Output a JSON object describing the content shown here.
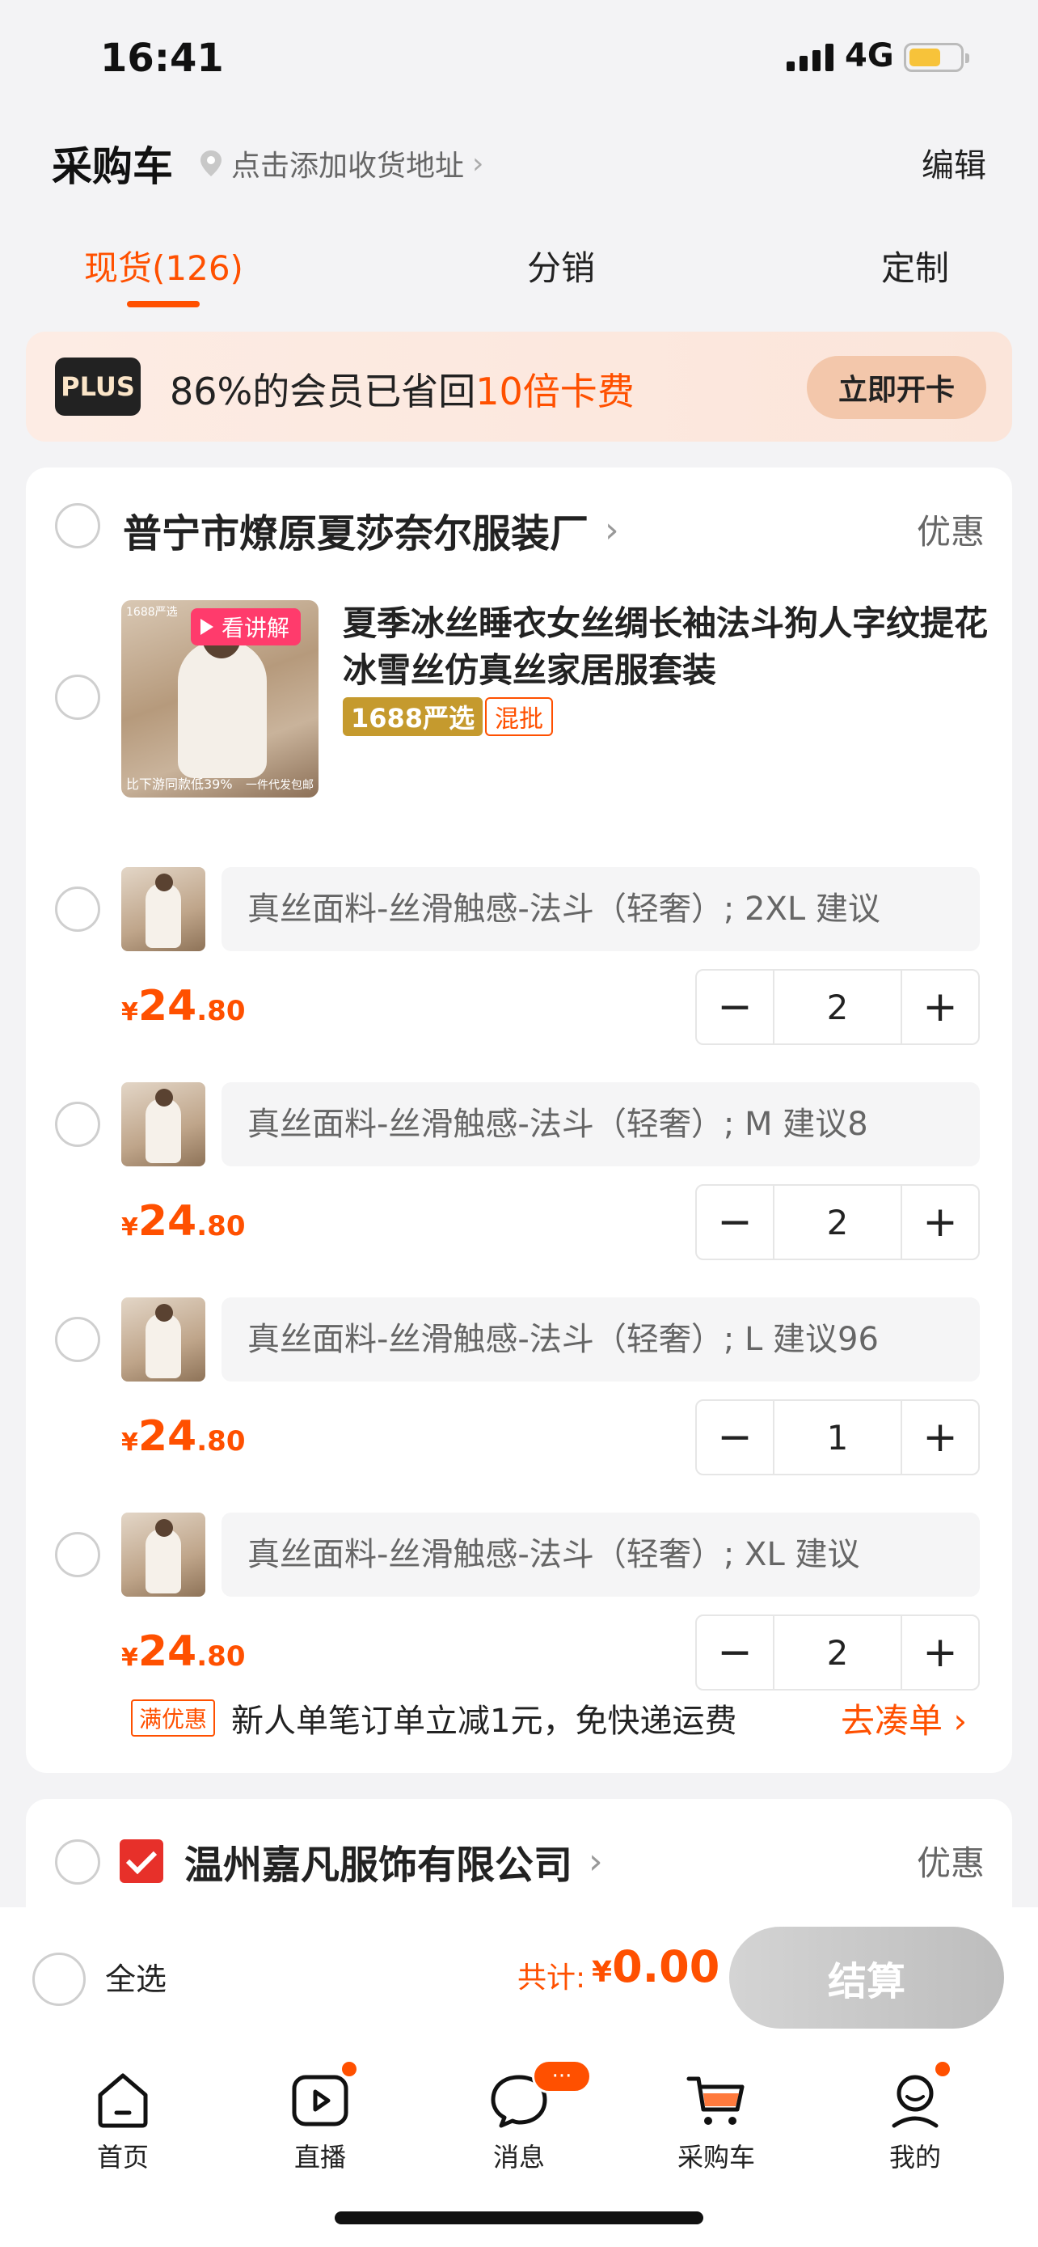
{
  "status_bar": {
    "time": "16:41",
    "network": "4G"
  },
  "header": {
    "title": "采购车",
    "address_hint": "点击添加收货地址",
    "edit_label": "编辑"
  },
  "tabs": [
    {
      "label": "现货(126)",
      "active": true
    },
    {
      "label": "分销",
      "active": false
    },
    {
      "label": "定制",
      "active": false
    }
  ],
  "plus_banner": {
    "badge": "PLUS",
    "text_prefix": "86%的会员已省回",
    "text_highlight": "10倍卡费",
    "button_label": "立即开卡"
  },
  "stores": [
    {
      "name": "普宁市燎原夏莎奈尔服装厂",
      "discount_label": "优惠",
      "product": {
        "title": "夏季冰丝睡衣女丝绸长袖法斗狗人字纹提花冰雪丝仿真丝家居服套装",
        "video_badge": "看讲解",
        "thumb_tag": "1688严选",
        "thumb_caption": "比下游同款低39%",
        "thumb_caption2": "一件代发包邮",
        "tag_yanxuan": "1688严选",
        "tag_hunpi": "混批"
      },
      "skus": [
        {
          "spec": "真丝面料-丝滑触感-法斗（轻奢）; 2XL 建议",
          "price_symbol": "¥",
          "price_int": "24",
          "price_dec": ".80",
          "quantity": "2"
        },
        {
          "spec": "真丝面料-丝滑触感-法斗（轻奢）; M 建议8",
          "price_symbol": "¥",
          "price_int": "24",
          "price_dec": ".80",
          "quantity": "2"
        },
        {
          "spec": "真丝面料-丝滑触感-法斗（轻奢）; L 建议96",
          "price_symbol": "¥",
          "price_int": "24",
          "price_dec": ".80",
          "quantity": "1"
        },
        {
          "spec": "真丝面料-丝滑触感-法斗（轻奢）; XL 建议",
          "price_symbol": "¥",
          "price_int": "24",
          "price_dec": ".80",
          "quantity": "2"
        }
      ],
      "promo": {
        "tag": "满优惠",
        "text": "新人单笔订单立减1元，免快递运费",
        "link": "去凑单"
      }
    },
    {
      "name": "温州嘉凡服饰有限公司",
      "discount_label": "优惠"
    }
  ],
  "checkout": {
    "select_all": "全选",
    "total_label": "共计:",
    "total_symbol": "¥",
    "total_value": "0.00",
    "button_label": "结算"
  },
  "tabbar": [
    {
      "label": "首页",
      "icon": "home-icon"
    },
    {
      "label": "直播",
      "icon": "live-icon"
    },
    {
      "label": "消息",
      "icon": "message-icon",
      "badge": "···"
    },
    {
      "label": "采购车",
      "icon": "cart-icon",
      "active": true
    },
    {
      "label": "我的",
      "icon": "profile-icon"
    }
  ],
  "colors": {
    "accent": "#ff5000",
    "background": "#f3f3f5"
  }
}
